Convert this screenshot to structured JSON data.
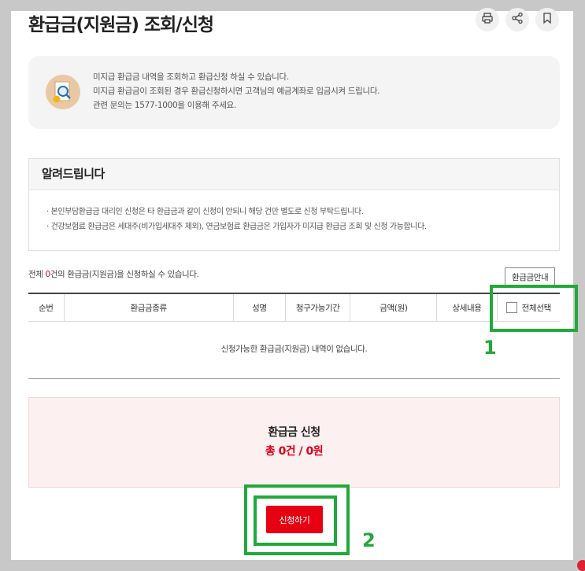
{
  "page": {
    "title": "환급금(지원금) 조회/신청"
  },
  "toolbar": {
    "print_icon": "print-icon",
    "share_icon": "share-icon",
    "bookmark_icon": "bookmark-icon"
  },
  "info": {
    "icon": "search-document-icon",
    "lines": [
      "미지급 환급금 내역을 조회하고 환급신청 하실 수 있습니다.",
      "미지급 환급금이 조회된 경우 환급신청하시면 고객님의 예금계좌로 입금시켜 드립니다.",
      "관련 문의는 1577-1000을 이용해 주세요."
    ]
  },
  "notice": {
    "heading": "알려드립니다",
    "items": [
      "본인부담환급금 대리인 신청은 타 환급금과 같이 신청이 안되니 해당 건만 별도로 신청 부탁드립니다.",
      "건강보험료 환급금은 세대주(비가입세대주 제외), 연금보험료 환급금은 가입자가 미지급 환급금 조회 및 신청 가능합니다."
    ]
  },
  "summary": {
    "prefix": "전체 ",
    "count": "0",
    "suffix": "건의 환급금(지원금)을 신청하실 수 있습니다."
  },
  "guide_button": "환급금안내",
  "table": {
    "headers": [
      "순번",
      "환급금종류",
      "성명",
      "청구가능기간",
      "금액(원)",
      "상세내용",
      "전체선택"
    ],
    "empty_message": "신청가능한 환급금(지원금) 내역이 없습니다."
  },
  "apply": {
    "title": "환급금 신청",
    "total": "총 0건 / 0원"
  },
  "submit_button": "신청하기",
  "annotations": {
    "label_1": "1",
    "label_2": "2",
    "color": "#22a83b"
  },
  "colors": {
    "accent": "#e60012",
    "apply_bg": "#fdf0f0",
    "highlight": "#22a83b"
  }
}
